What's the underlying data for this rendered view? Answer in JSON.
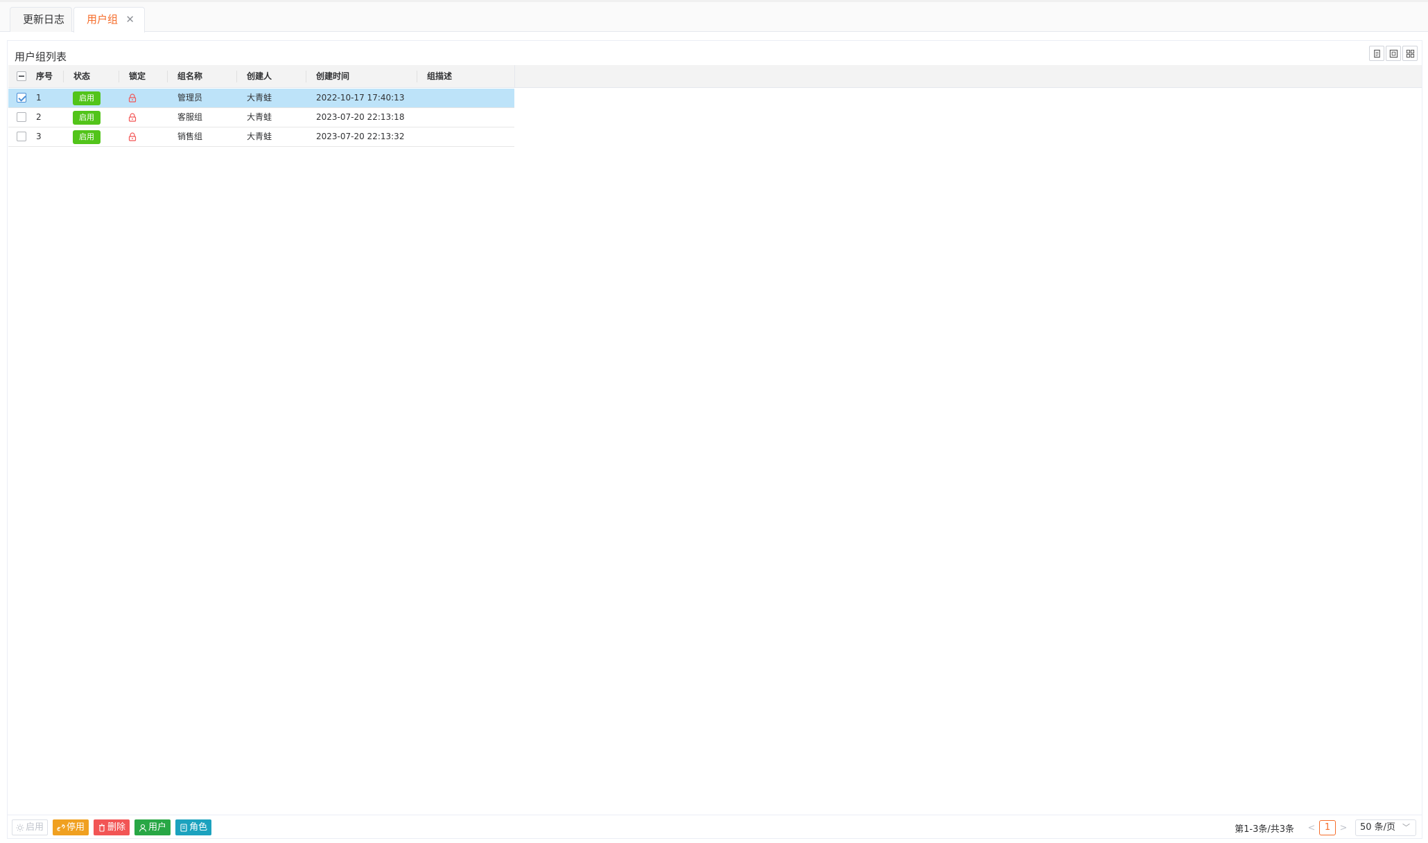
{
  "tabs": [
    {
      "label": "更新日志",
      "active": false
    },
    {
      "label": "用户组",
      "active": true,
      "closable": true
    }
  ],
  "panel": {
    "title": "用户组列表",
    "tools": [
      "export-icon",
      "fullscreen-icon",
      "columns-icon"
    ]
  },
  "table": {
    "columns": [
      "序号",
      "状态",
      "锁定",
      "组名称",
      "创建人",
      "创建时间",
      "组描述"
    ],
    "rows": [
      {
        "index": "1",
        "status": "启用",
        "locked": true,
        "name": "管理员",
        "creator": "大青蛙",
        "created": "2022-10-17 17:40:13",
        "desc": "",
        "selected": true
      },
      {
        "index": "2",
        "status": "启用",
        "locked": true,
        "name": "客服组",
        "creator": "大青蛙",
        "created": "2023-07-20 22:13:18",
        "desc": "",
        "selected": false
      },
      {
        "index": "3",
        "status": "启用",
        "locked": true,
        "name": "销售组",
        "creator": "大青蛙",
        "created": "2023-07-20 22:13:32",
        "desc": "",
        "selected": false
      }
    ]
  },
  "actions": {
    "enable": "启用",
    "disable": "停用",
    "delete": "删除",
    "users": "用户",
    "roles": "角色"
  },
  "pager": {
    "summary": "第1-3条/共3条",
    "prev": "<",
    "current": "1",
    "next": ">",
    "page_size": "50 条/页"
  },
  "colors": {
    "accent": "#f56c2a",
    "status_badge": "#52c41a",
    "selected_row": "#bde3f9",
    "lock": "#f25555"
  }
}
